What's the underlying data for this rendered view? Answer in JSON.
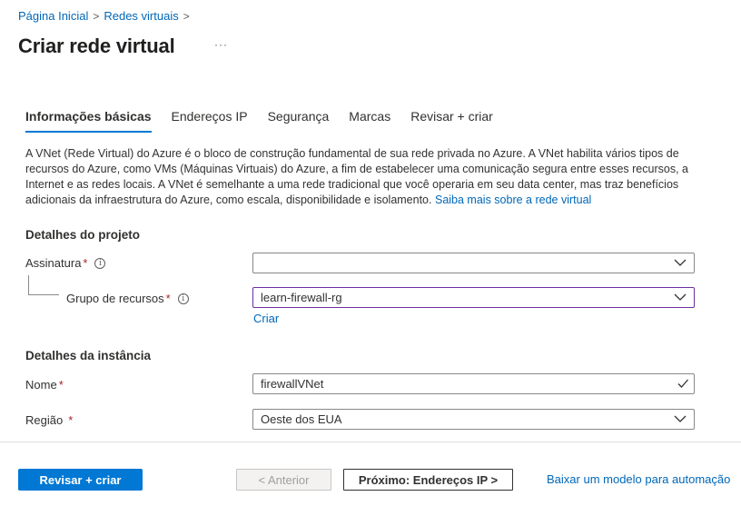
{
  "breadcrumb": {
    "home": "Página Inicial",
    "sep1": ">",
    "vnets": "Redes virtuais",
    "sep2": ">"
  },
  "page": {
    "title": "Criar rede virtual",
    "more": "···"
  },
  "tabs": [
    {
      "label": "Informações básicas"
    },
    {
      "label": "Endereços IP"
    },
    {
      "label": "Segurança"
    },
    {
      "label": "Marcas"
    },
    {
      "label": "Revisar + criar"
    }
  ],
  "intro": {
    "text": "A VNet (Rede Virtual) do Azure é o bloco de construção fundamental de sua rede privada no Azure. A VNet habilita vários tipos de recursos do Azure, como VMs (Máquinas Virtuais) do Azure, a fim de estabelecer uma comunicação segura entre esses recursos, a Internet e as redes locais. A VNet é semelhante a uma rede tradicional que você operaria em seu data center, mas traz benefícios adicionais da infraestrutura do Azure, como escala, disponibilidade e isolamento.",
    "link": "Saiba mais sobre a rede virtual"
  },
  "project": {
    "title": "Detalhes do projeto",
    "subscription_label": "Assinatura",
    "subscription_value": "",
    "rg_label": "Grupo de recursos",
    "rg_value": "learn-firewall-rg",
    "create_link": "Criar",
    "required": "*",
    "info": "i"
  },
  "instance": {
    "title": "Detalhes da instância",
    "name_label": "Nome",
    "name_value": "firewallVNet",
    "region_label": "Região",
    "region_value": "Oeste dos EUA",
    "required": "*"
  },
  "footer": {
    "review_create": "Revisar + criar",
    "previous": "< Anterior",
    "next": "Próximo: Endereços IP >",
    "download_template": "Baixar um modelo para automação"
  },
  "colors": {
    "accent": "#0078d4",
    "link": "#0067b8",
    "required": "#a4262c",
    "focus": "#6b2fa3"
  }
}
